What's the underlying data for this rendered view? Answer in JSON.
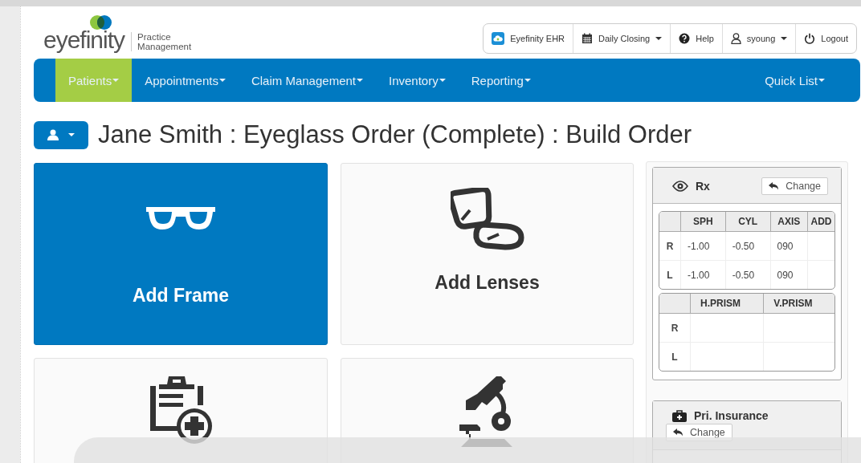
{
  "logo": {
    "brand": "eyefinity",
    "tagline": "Practice Management"
  },
  "top_links": [
    {
      "label": "Eyefinity EHR",
      "kind": "cloud",
      "caret": false
    },
    {
      "label": "Daily Closing",
      "kind": "calendar",
      "caret": true
    },
    {
      "label": "Help",
      "kind": "help",
      "caret": false
    },
    {
      "label": "syoung",
      "kind": "user",
      "caret": true
    },
    {
      "label": "Logout",
      "kind": "power",
      "caret": false
    }
  ],
  "nav": {
    "items": [
      {
        "label": "Patients",
        "selected": true
      },
      {
        "label": "Appointments",
        "selected": false
      },
      {
        "label": "Claim Management",
        "selected": false
      },
      {
        "label": "Inventory",
        "selected": false
      },
      {
        "label": "Reporting",
        "selected": false
      }
    ],
    "quick_list": "Quick List"
  },
  "page_title": "Jane Smith : Eyeglass Order (Complete) : Build Order",
  "tiles": [
    {
      "label": "Add Frame",
      "kind": "frame",
      "selected": true
    },
    {
      "label": "Add Lenses",
      "kind": "lenses",
      "selected": false
    },
    {
      "kind": "clipboard",
      "selected": false
    },
    {
      "kind": "microscope",
      "selected": false
    }
  ],
  "rx": {
    "title": "Rx",
    "change": "Change",
    "table": {
      "columns": [
        "SPH",
        "CYL",
        "AXIS",
        "ADD"
      ],
      "rows": [
        {
          "eye": "R",
          "values": [
            "-1.00",
            "-0.50",
            "090"
          ]
        },
        {
          "eye": "L",
          "values": [
            "-1.00",
            "-0.50",
            "090"
          ]
        }
      ]
    },
    "prism": {
      "columns": [
        "H.PRISM",
        "V.PRISM"
      ],
      "rows": [
        {
          "eye": "R"
        },
        {
          "eye": "L"
        }
      ]
    }
  },
  "insurance": {
    "title": "Pri. Insurance",
    "change": "Change"
  }
}
